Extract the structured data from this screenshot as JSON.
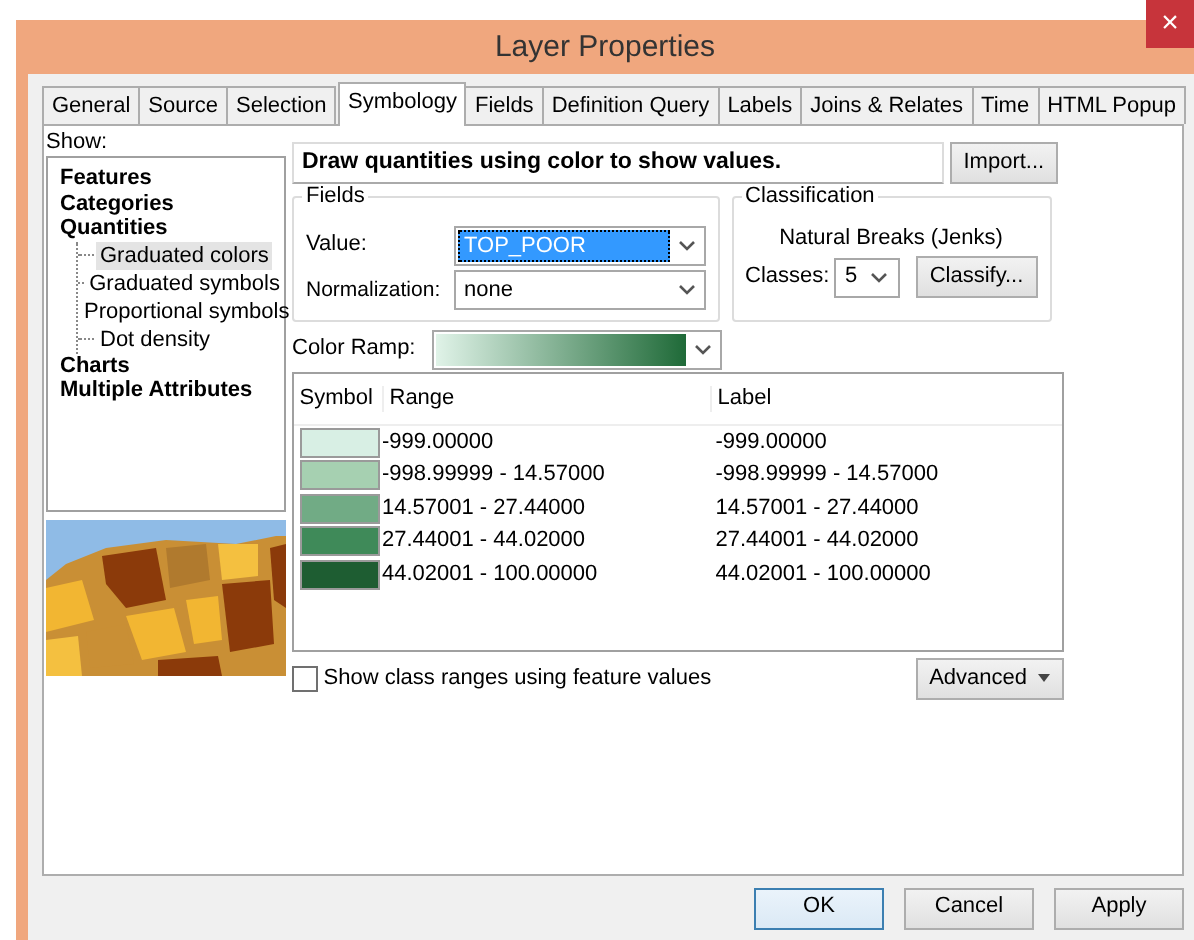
{
  "window": {
    "title": "Layer Properties",
    "close": "×"
  },
  "tabs": [
    {
      "label": "General",
      "selected": false
    },
    {
      "label": "Source",
      "selected": false
    },
    {
      "label": "Selection",
      "selected": false
    },
    {
      "label": "Symbology",
      "selected": true
    },
    {
      "label": "Fields",
      "selected": false
    },
    {
      "label": "Definition Query",
      "selected": false
    },
    {
      "label": "Labels",
      "selected": false
    },
    {
      "label": "Joins & Relates",
      "selected": false
    },
    {
      "label": "Time",
      "selected": false
    },
    {
      "label": "HTML Popup",
      "selected": false
    }
  ],
  "show": {
    "label": "Show:",
    "items": [
      {
        "label": "Features",
        "selected": false
      },
      {
        "label": "Categories",
        "selected": false
      },
      {
        "label": "Quantities",
        "selected": false,
        "children": [
          {
            "label": "Graduated colors",
            "selected": true
          },
          {
            "label": "Graduated symbols",
            "selected": false
          },
          {
            "label": "Proportional symbols",
            "selected": false
          },
          {
            "label": "Dot density",
            "selected": false
          }
        ]
      },
      {
        "label": "Charts",
        "selected": false
      },
      {
        "label": "Multiple Attributes",
        "selected": false
      }
    ]
  },
  "description": "Draw quantities using color to show values.",
  "import_button": "Import...",
  "fields": {
    "title": "Fields",
    "value_label": "Value:",
    "value": "TOP_POOR",
    "value_focused": true,
    "normalization_label": "Normalization:",
    "normalization": "none"
  },
  "classification": {
    "title": "Classification",
    "method": "Natural Breaks (Jenks)",
    "classes_label": "Classes:",
    "classes": "5",
    "classify_button": "Classify..."
  },
  "color_ramp": {
    "label": "Color Ramp:"
  },
  "table": {
    "columns": [
      "Symbol",
      "Range",
      "Label"
    ],
    "rows": [
      {
        "color": "#d8efe4",
        "range": "-999.00000",
        "label": "-999.00000"
      },
      {
        "color": "#a6d0b1",
        "range": "-998.99999 - 14.57000",
        "label": "-998.99999 - 14.57000"
      },
      {
        "color": "#71ab85",
        "range": "14.57001 - 27.44000",
        "label": "14.57001 - 27.44000"
      },
      {
        "color": "#3f8a59",
        "range": "27.44001 - 44.02000",
        "label": "27.44001 - 44.02000"
      },
      {
        "color": "#1e5d32",
        "range": "44.02001 - 100.00000",
        "label": "44.02001 - 100.00000"
      }
    ]
  },
  "show_class_ranges": {
    "label": "Show class ranges using feature values",
    "checked": false
  },
  "advanced_button": "Advanced",
  "buttons": [
    {
      "label": "OK",
      "default": true
    },
    {
      "label": "Cancel",
      "default": false
    },
    {
      "label": "Apply",
      "default": false
    }
  ]
}
